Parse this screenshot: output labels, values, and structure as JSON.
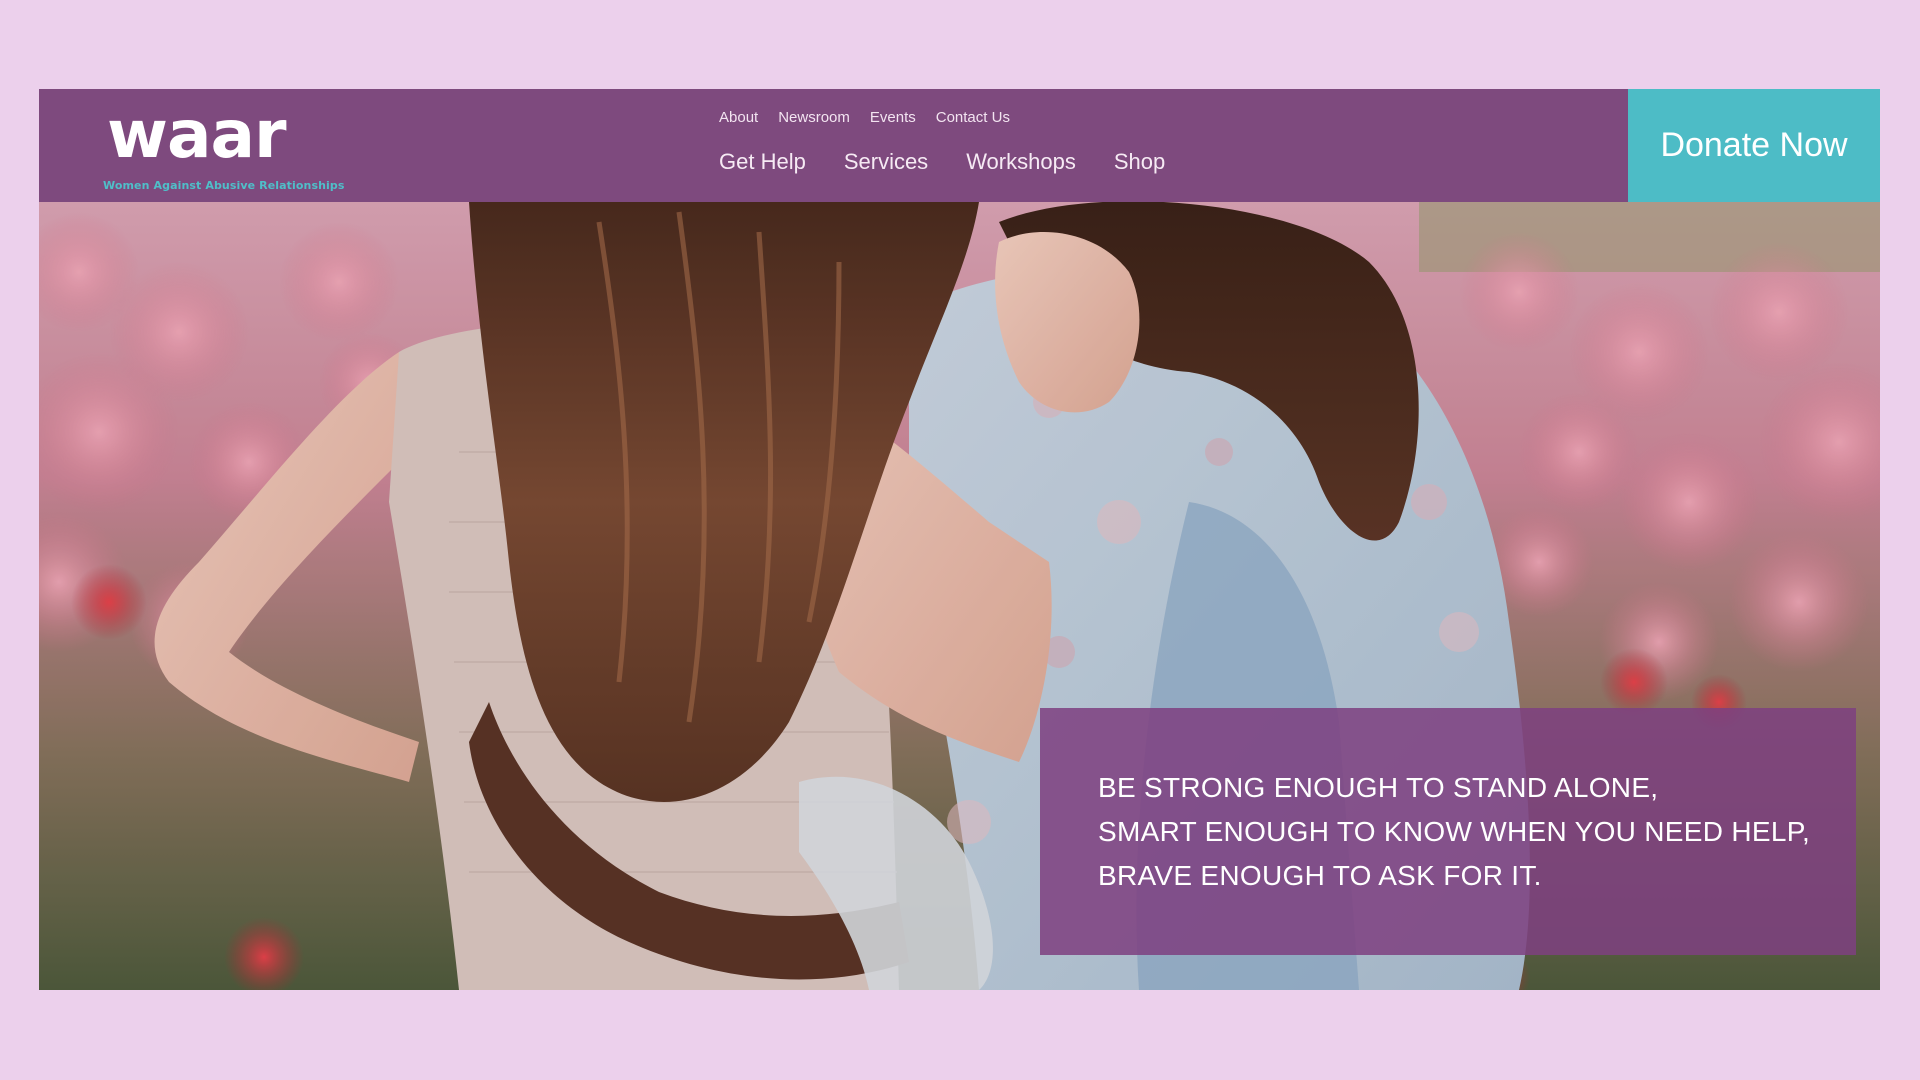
{
  "brand": {
    "logo_text": "waar",
    "tagline": "Women Against Abusive Relationships"
  },
  "nav": {
    "secondary": [
      "About",
      "Newsroom",
      "Events",
      "Contact Us"
    ],
    "primary": [
      "Get Help",
      "Services",
      "Workshops",
      "Shop"
    ]
  },
  "donate": {
    "label": "Donate Now"
  },
  "hero": {
    "image": "two-women-embracing-in-tulip-field",
    "quote": [
      "BE STRONG ENOUGH TO STAND ALONE,",
      "SMART ENOUGH TO KNOW WHEN YOU NEED HELP,",
      "BRAVE ENOUGH TO ASK FOR IT."
    ]
  },
  "colors": {
    "page_background": "#ecd0ec",
    "header_purple": "#7e4a7e",
    "donate_teal": "#4dbcc6",
    "tagline_teal": "#4fbfc9",
    "quote_overlay": "#7e4080"
  }
}
